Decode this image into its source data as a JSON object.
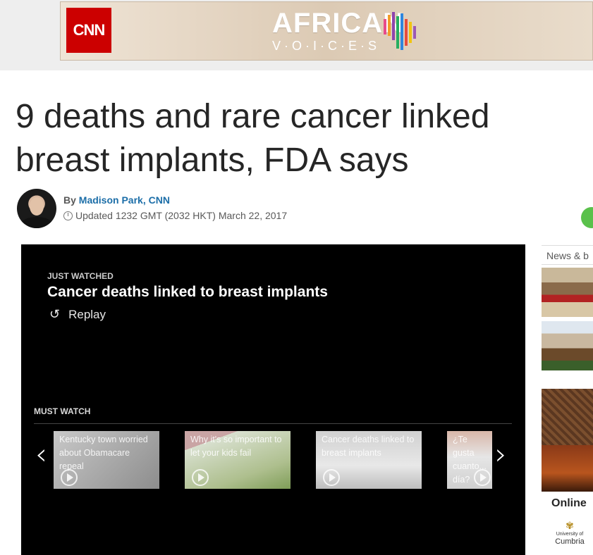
{
  "banner": {
    "logo_text": "CNN",
    "title": "AFRICAN",
    "subtitle": "V·O·I·C·E·S"
  },
  "article": {
    "headline_line1": "9 deaths and rare cancer linked",
    "headline_line2": "breast implants, FDA says",
    "by_prefix": "By ",
    "author": "Madison Park, CNN",
    "updated": "Updated 1232 GMT (2032 HKT) March 22, 2017"
  },
  "video": {
    "just_watched_label": "JUST WATCHED",
    "title": "Cancer deaths linked to breast implants",
    "replay_label": "Replay",
    "must_watch_label": "MUST WATCH",
    "prev_glyph": "‹",
    "next_glyph": "›",
    "thumbnails": [
      {
        "caption": "Kentucky town worried about Obamacare repeal",
        "color": "#9a9a9a"
      },
      {
        "caption": "Why it's so important to let your kids fail",
        "color": "#7a8f5a"
      },
      {
        "caption": "Cancer deaths linked to breast implants",
        "color": "#b7b7b7"
      },
      {
        "caption": "¿Te gusta cuanto... día?",
        "color": "#a67b6a"
      }
    ]
  },
  "sidebar": {
    "heading": "News & b",
    "online_label": "Online",
    "uni_line1": "University of",
    "uni_line2": "Cumbria"
  },
  "colors": {
    "cnn_red": "#cc0000",
    "link_blue": "#1c6ea8",
    "share_green": "#5ac14b"
  }
}
